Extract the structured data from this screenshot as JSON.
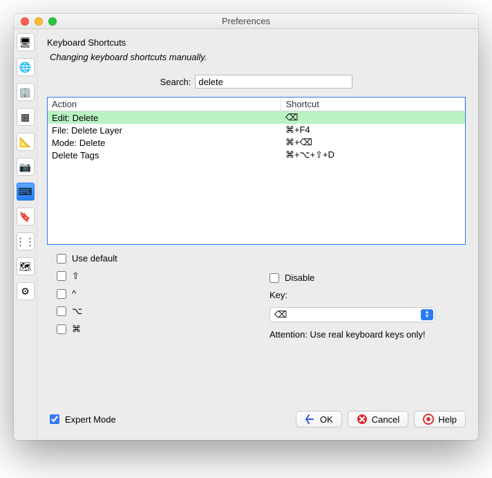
{
  "window": {
    "title": "Preferences"
  },
  "panel": {
    "title": "Keyboard Shortcuts",
    "description": "Changing keyboard shortcuts manually."
  },
  "search": {
    "label": "Search:",
    "value": "delete"
  },
  "table": {
    "headers": {
      "action": "Action",
      "shortcut": "Shortcut"
    },
    "rows": [
      {
        "action": "Edit: Delete",
        "shortcut": "⌫",
        "selected": true
      },
      {
        "action": "File: Delete Layer",
        "shortcut": "⌘+F4",
        "selected": false
      },
      {
        "action": "Mode: Delete",
        "shortcut": "⌘+⌫",
        "selected": false
      },
      {
        "action": "Delete Tags",
        "shortcut": "⌘+⌥+⇧+D",
        "selected": false
      }
    ]
  },
  "options": {
    "use_default": {
      "label": "Use default",
      "checked": false
    },
    "shift": {
      "label": "⇧",
      "checked": false
    },
    "ctrl": {
      "label": "^",
      "checked": false
    },
    "alt": {
      "label": "⌥",
      "checked": false
    },
    "meta": {
      "label": "⌘",
      "checked": false
    },
    "disable": {
      "label": "Disable",
      "checked": false
    },
    "key_label": "Key:",
    "key_value": "⌫",
    "attention": "Attention: Use real keyboard keys only!"
  },
  "footer": {
    "expert_mode": {
      "label": "Expert Mode",
      "checked": true
    },
    "ok": "OK",
    "cancel": "Cancel",
    "help": "Help"
  },
  "sidebar": {
    "items": [
      {
        "name": "display",
        "glyph": "🖥",
        "selected": false
      },
      {
        "name": "globe",
        "glyph": "🌐",
        "selected": false
      },
      {
        "name": "building",
        "glyph": "🏢",
        "selected": false
      },
      {
        "name": "grid",
        "glyph": "▦",
        "selected": false
      },
      {
        "name": "ruler",
        "glyph": "📐",
        "selected": false
      },
      {
        "name": "camera",
        "glyph": "📷",
        "selected": false
      },
      {
        "name": "keyboard",
        "glyph": "⌨",
        "selected": true
      },
      {
        "name": "tag",
        "glyph": "🔖",
        "selected": false
      },
      {
        "name": "nodes",
        "glyph": "⋮⋮",
        "selected": false
      },
      {
        "name": "map",
        "glyph": "🗺",
        "selected": false
      },
      {
        "name": "advanced",
        "glyph": "⚙",
        "selected": false
      }
    ]
  }
}
